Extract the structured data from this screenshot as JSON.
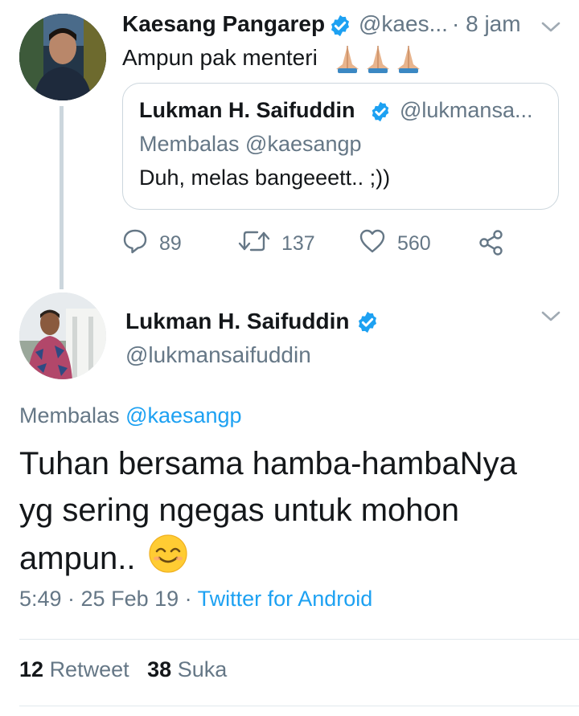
{
  "quoted_thread_tweet": {
    "author_name": "Kaesang Pangarep",
    "author_handle": "@kaes...",
    "separator_time": "· 8 jam",
    "text": "Ampun pak menteri",
    "emoji": "folded-hands-emoji x3",
    "quoted_tweet": {
      "author_name": "Lukman H. Saifuddin",
      "author_handle": "@lukmansa...",
      "reply_to": "Membalas @kaesangp",
      "text": "Duh, melas bangeeett.. ;))"
    },
    "actions": {
      "reply_count": "89",
      "retweet_count": "137",
      "like_count": "560"
    }
  },
  "main_tweet": {
    "author_name": "Lukman H. Saifuddin",
    "author_handle": "@lukmansaifuddin",
    "reply_prefix": "Membalas",
    "reply_mention": "@kaesangp",
    "text": "Tuhan bersama hamba-hambaNya yg sering ngegas untuk mohon ampun..",
    "emoji": "smiling-face-emoji",
    "timestamp": "5:49 · 25 Feb 19 ·",
    "source": "Twitter for Android",
    "retweet_count": "12",
    "retweet_label": "Retweet",
    "like_count": "38",
    "like_label": "Suka"
  },
  "colors": {
    "accent": "#1da1f2",
    "secondary_text": "#657786",
    "border": "#ccd6dd"
  }
}
